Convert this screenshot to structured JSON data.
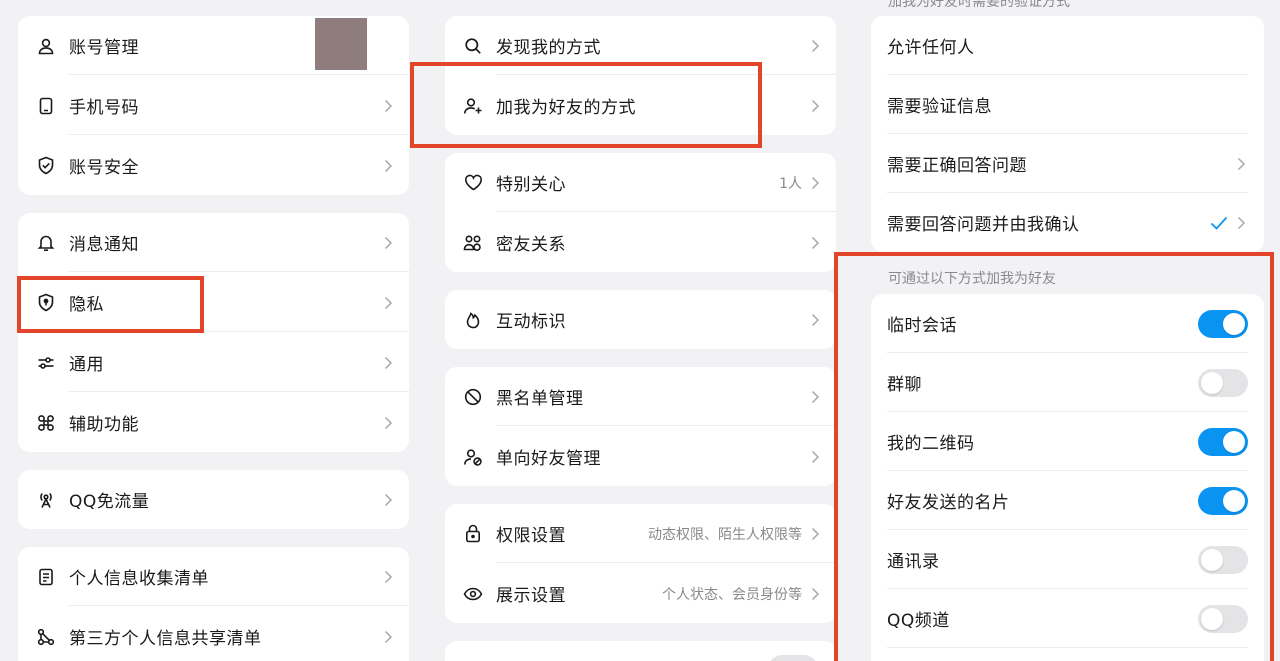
{
  "left": {
    "card1": [
      {
        "label": "账号管理",
        "icon": "person-icon"
      },
      {
        "label": "手机号码",
        "icon": "phone-icon"
      },
      {
        "label": "账号安全",
        "icon": "shield-check-icon"
      }
    ],
    "card2": [
      {
        "label": "消息通知",
        "icon": "bell-icon"
      },
      {
        "label": "隐私",
        "icon": "privacy-shield-icon"
      },
      {
        "label": "通用",
        "icon": "sliders-icon"
      },
      {
        "label": "辅助功能",
        "icon": "command-icon"
      }
    ],
    "card3": [
      {
        "label": "QQ免流量",
        "icon": "signal-tower-icon"
      }
    ],
    "card4": [
      {
        "label": "个人信息收集清单",
        "icon": "document-icon"
      },
      {
        "label": "第三方个人信息共享清单",
        "icon": "share-nodes-icon"
      }
    ]
  },
  "middle": {
    "card1": [
      {
        "label": "发现我的方式",
        "icon": "search-icon"
      },
      {
        "label": "加我为好友的方式",
        "icon": "add-friend-icon"
      }
    ],
    "card2": [
      {
        "label": "特别关心",
        "icon": "heart-icon",
        "value": "1人"
      },
      {
        "label": "密友关系",
        "icon": "close-friends-icon"
      }
    ],
    "card3": [
      {
        "label": "互动标识",
        "icon": "flame-icon"
      }
    ],
    "card4": [
      {
        "label": "黑名单管理",
        "icon": "block-icon"
      },
      {
        "label": "单向好友管理",
        "icon": "one-way-friend-icon"
      }
    ],
    "card5": [
      {
        "label": "权限设置",
        "icon": "lock-icon",
        "value": "动态权限、陌生人权限等"
      },
      {
        "label": "展示设置",
        "icon": "eye-icon",
        "value": "个人状态、会员身份等"
      }
    ]
  },
  "right": {
    "header_partial": "加我为好友时需要的验证方式",
    "verify_options": [
      {
        "label": "允许任何人",
        "chevron": false,
        "checked": false
      },
      {
        "label": "需要验证信息",
        "chevron": false,
        "checked": false
      },
      {
        "label": "需要正确回答问题",
        "chevron": true,
        "checked": false
      },
      {
        "label": "需要回答问题并由我确认",
        "chevron": true,
        "checked": true
      }
    ],
    "ways_title": "可通过以下方式加我为好友",
    "ways": [
      {
        "label": "临时会话",
        "on": true
      },
      {
        "label": "群聊",
        "on": false
      },
      {
        "label": "我的二维码",
        "on": true
      },
      {
        "label": "好友发送的名片",
        "on": true
      },
      {
        "label": "通讯录",
        "on": false
      },
      {
        "label": "QQ频道",
        "on": false
      }
    ]
  },
  "colors": {
    "accent": "#0a94f2",
    "highlight": "#e2452a",
    "redacted": "#8f7d7d"
  }
}
